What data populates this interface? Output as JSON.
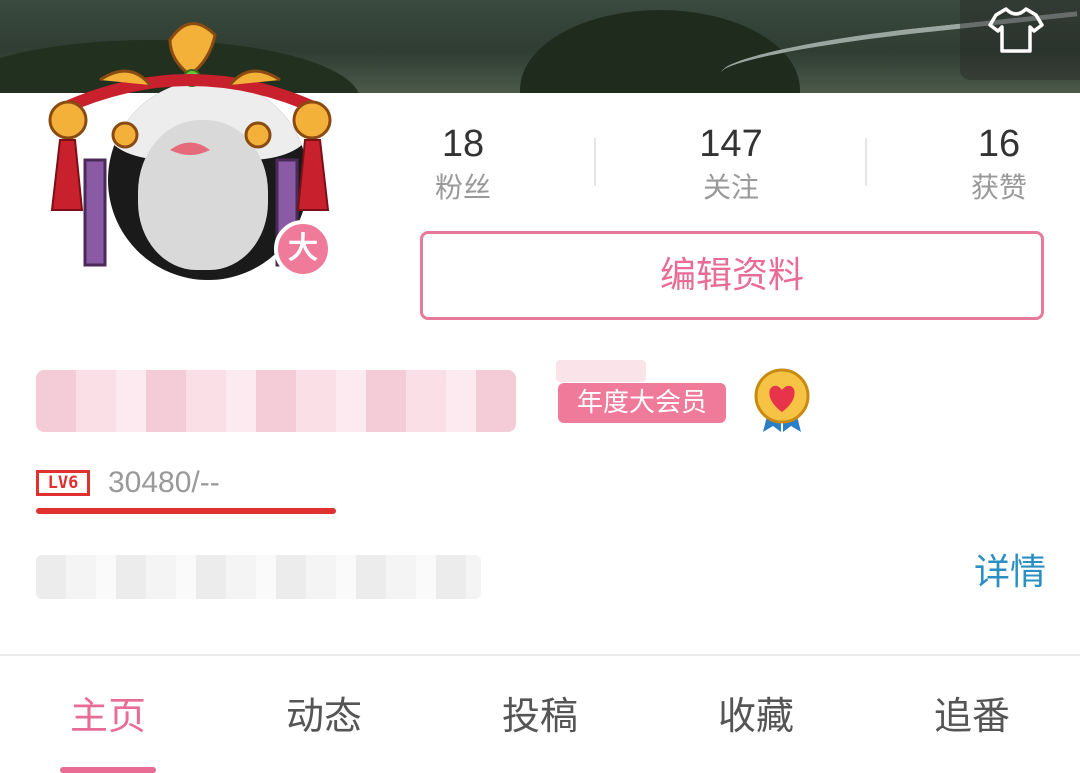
{
  "skin_button": {
    "icon": "shirt-icon"
  },
  "avatar": {
    "badge_label": "大"
  },
  "stats": {
    "fans": {
      "value": "18",
      "label": "粉丝"
    },
    "following": {
      "value": "147",
      "label": "关注"
    },
    "likes": {
      "value": "16",
      "label": "获赞"
    }
  },
  "edit_profile_label": "编辑资料",
  "vip_badge_label": "年度大会员",
  "level": {
    "badge": "LV6",
    "exp_text": "30480/--",
    "progress": 1.0
  },
  "detail_link": "详情",
  "tabs": [
    {
      "label": "主页",
      "active": true
    },
    {
      "label": "动态",
      "active": false
    },
    {
      "label": "投稿",
      "active": false
    },
    {
      "label": "收藏",
      "active": false
    },
    {
      "label": "追番",
      "active": false
    }
  ],
  "colors": {
    "accent": "#e86c94",
    "level_red": "#e0302f",
    "link_blue": "#2b8fc3"
  }
}
